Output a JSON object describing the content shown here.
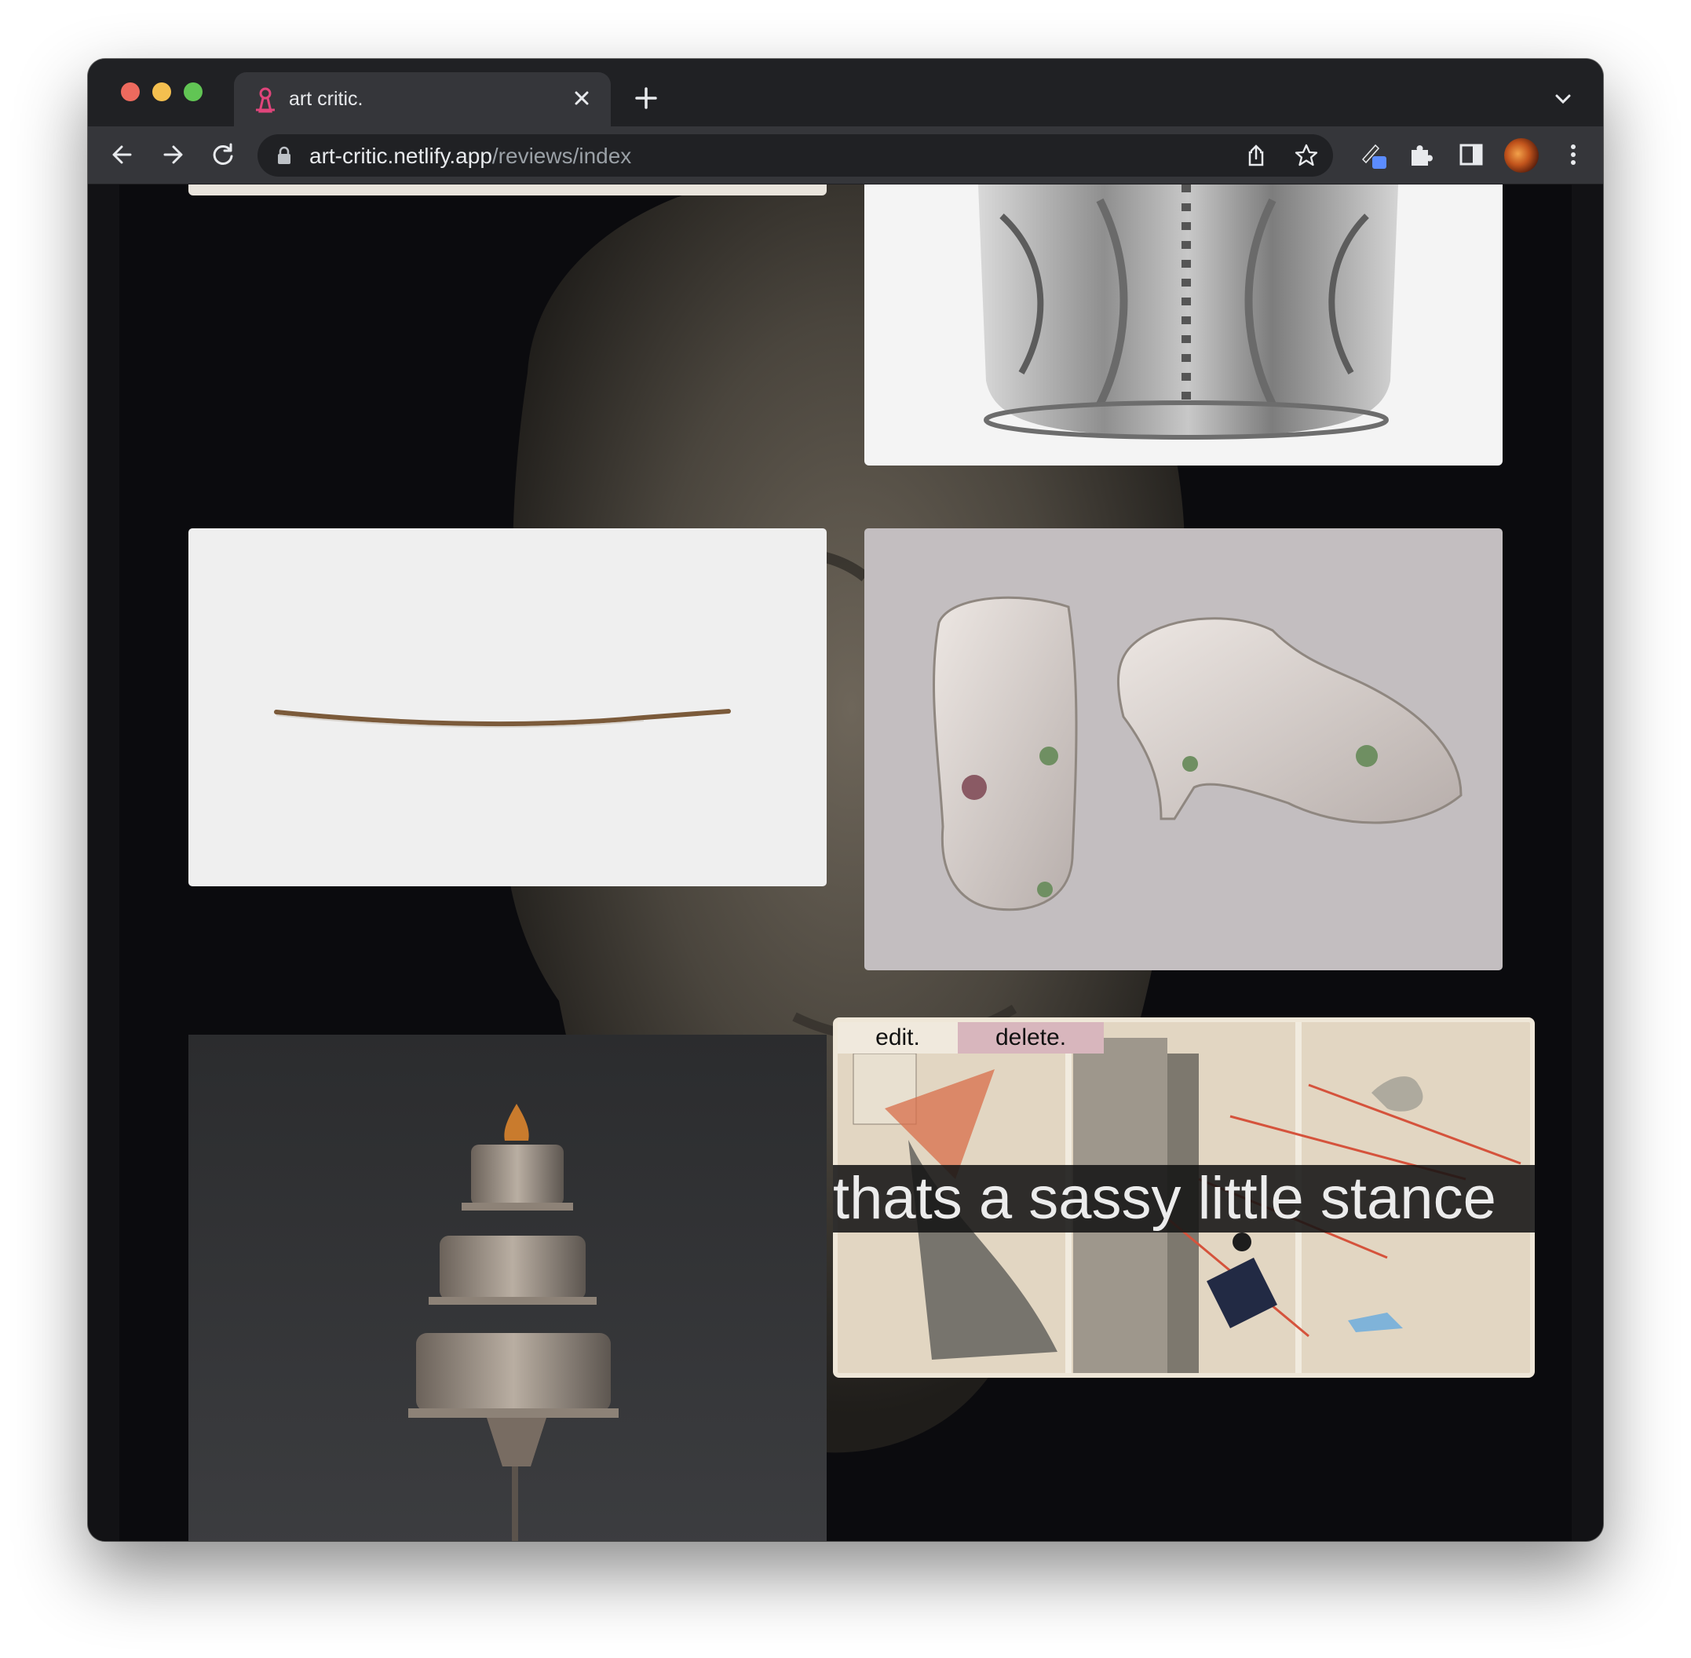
{
  "browser": {
    "tab": {
      "title": "art critic.",
      "favicon": "art-critic-favicon"
    },
    "url": {
      "host": "art-critic.netlify.app",
      "path": "/reviews/index"
    },
    "icons": {
      "back": "back-arrow-icon",
      "forward": "forward-arrow-icon",
      "reload": "reload-icon",
      "lock": "lock-icon",
      "share": "share-icon",
      "bookmark": "star-icon",
      "extension_pen": "pen-extension-icon",
      "extensions": "puzzle-icon",
      "side_panel": "side-panel-icon",
      "menu": "kebab-menu-icon",
      "tab_close": "close-icon",
      "new_tab": "plus-icon",
      "tab_list": "chevron-down-icon"
    }
  },
  "reviews": {
    "selected": {
      "edit_label": "edit.",
      "delete_label": "delete.",
      "caption": "thats a sassy little stance"
    }
  },
  "colors": {
    "chrome_dark": "#202124",
    "toolbar": "#35363a",
    "page_bg": "#0b0b0e",
    "delete_button": "#d8b6bd",
    "edit_button": "#f0e9dd"
  }
}
